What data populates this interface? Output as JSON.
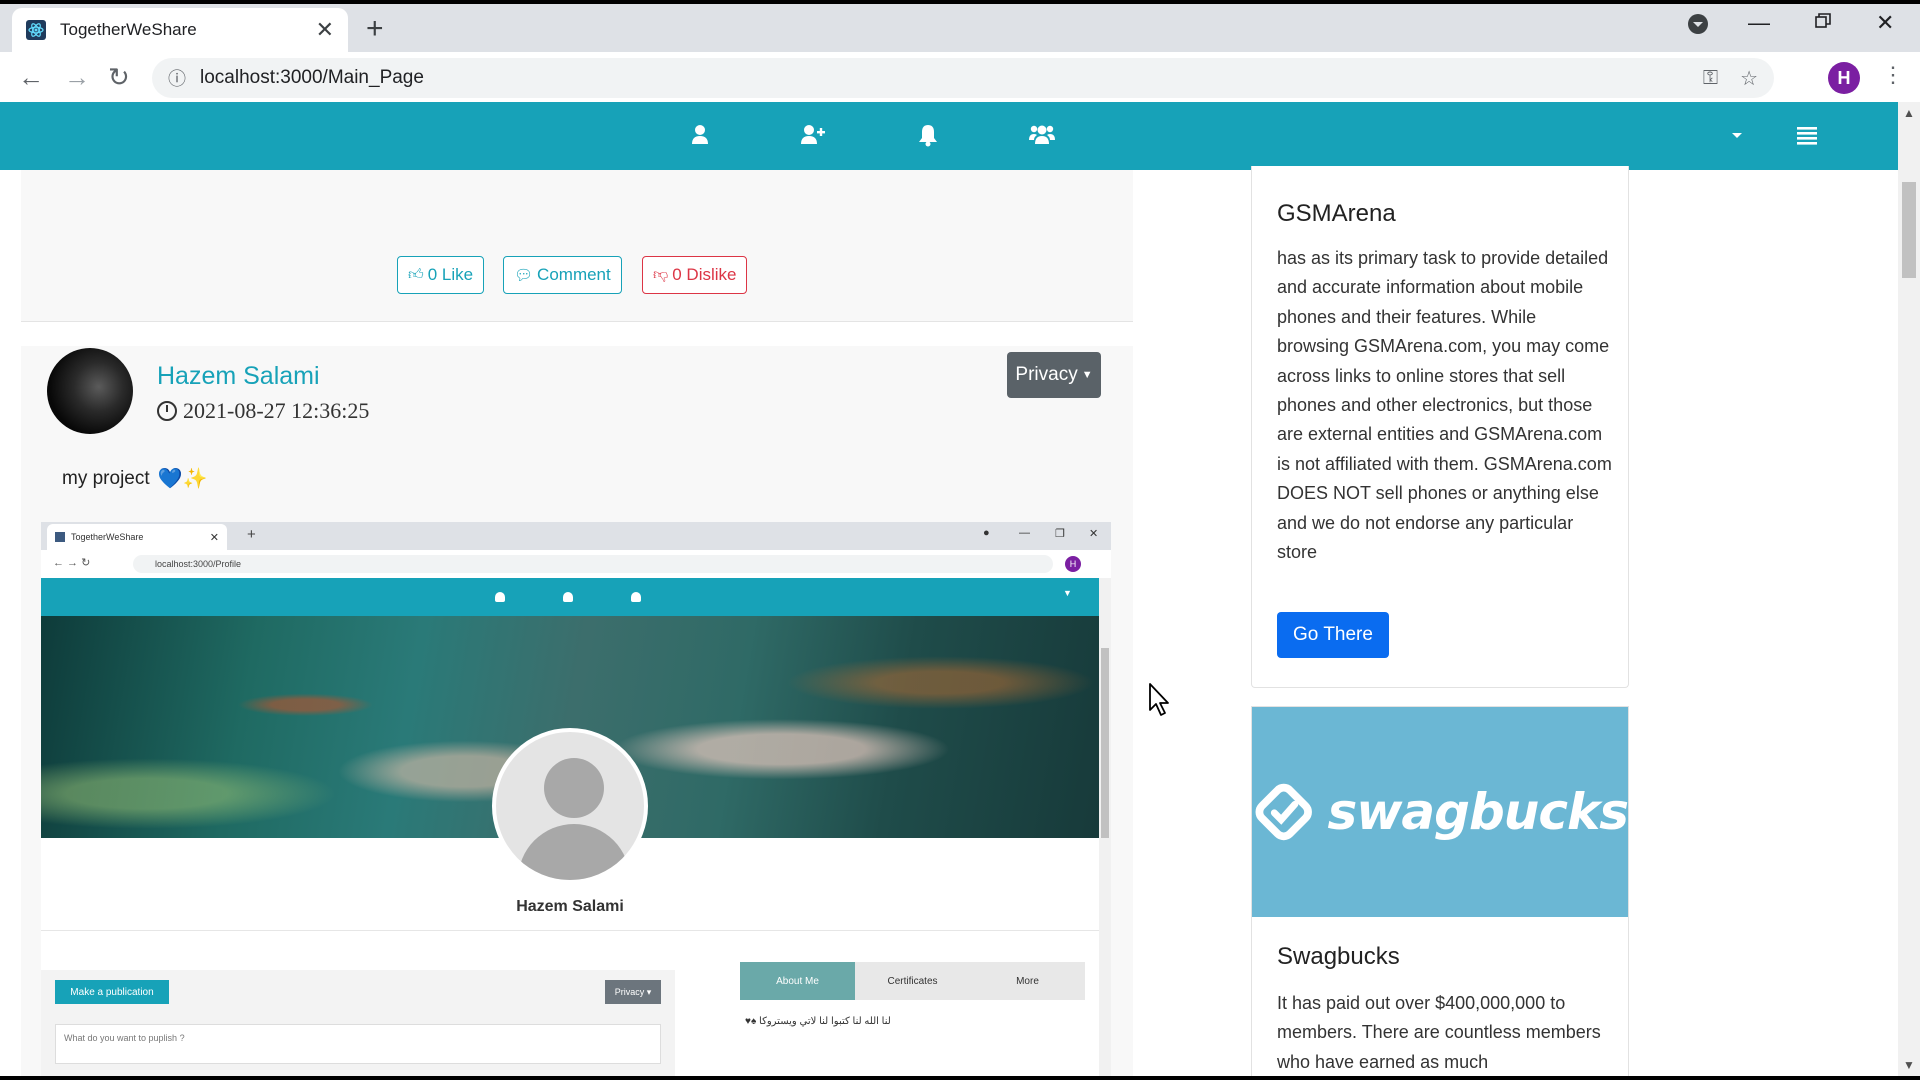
{
  "browser": {
    "tab_title": "TogetherWeShare",
    "url": "localhost:3000/Main_Page",
    "profile_initial": "H"
  },
  "prev_post": {
    "like_label": "0 Like",
    "comment_label": "Comment",
    "dislike_label": "0 Dislike"
  },
  "post": {
    "author": "Hazem Salami",
    "date": "2021-08-27 12:36:25",
    "privacy_label": "Privacy",
    "text": "my project",
    "emojis": "💙✨"
  },
  "embedded_screenshot": {
    "tab_title": "TogetherWeShare",
    "url": "localhost:3000/Profile",
    "profile_initial": "H",
    "profile_name": "Hazem Salami",
    "publish_button": "Make a publication",
    "privacy_label": "Privacy",
    "input_placeholder": "What do you want to puplish ?",
    "tabs": [
      "About Me",
      "Certificates",
      "More"
    ],
    "about_text": "لنا الله لنا كتبوا لنا لاتي ويستروكا ♠♥"
  },
  "sidebar": {
    "ad1": {
      "title": "GSMArena",
      "text": "has as its primary task to provide detailed and accurate information about mobile phones and their features. While browsing GSMArena.com, you may come across links to online stores that sell phones and other electronics, but those are external entities and GSMArena.com is not affiliated with them. GSMArena.com DOES NOT sell phones or anything else and we do not endorse any particular store",
      "button": "Go There"
    },
    "ad2": {
      "logo_text": "swagbucks",
      "title": "Swagbucks",
      "text": "It has paid out over $400,000,000 to members. There are countless members who have earned as much"
    }
  },
  "colors": {
    "navbar": "#17a2b8",
    "go_button": "#0a6cf0",
    "dislike": "#dc3545",
    "swagbucks_bg": "#6bb7d4"
  }
}
